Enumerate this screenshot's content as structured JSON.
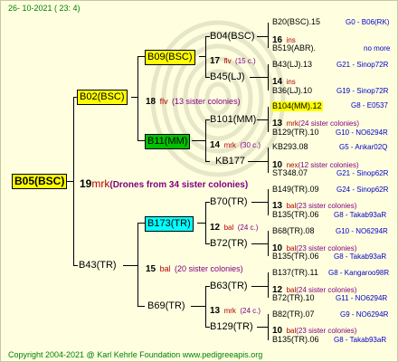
{
  "date": "26- 10-2021 (  23:  4)",
  "footer": "Copyright 2004-2021 @ Karl Kehrle Foundation    www.pedigreeapis.org",
  "root": {
    "name": "B05(BSC)",
    "num": "19",
    "race": "mrk",
    "colonies": "(Drones from 34 sister colonies)",
    "color": "#ffff00"
  },
  "gen1": [
    {
      "name": "B02(BSC)",
      "num": "18",
      "race": "flv",
      "colonies": "(13 sister colonies)",
      "color": "#ffff00"
    },
    {
      "name": "B43(TR)",
      "num": "15",
      "race": "bal",
      "colonies": "(20 sister colonies)"
    }
  ],
  "gen2": [
    {
      "name": "B09(BSC)",
      "num": "17",
      "race": "flv",
      "colonies": "(15 c.)",
      "color": "#ffff00"
    },
    {
      "name": "B11(MM)",
      "num": "14",
      "race": "mrk",
      "colonies": "(30 c.)",
      "color": "#00c000"
    },
    {
      "name": "B173(TR)",
      "num": "12",
      "race": "bal",
      "colonies": "(24 c.)",
      "color": "#00ffff"
    },
    {
      "name": "B69(TR)",
      "num": "13",
      "race": "mrk",
      "colonies": "(24 c.)"
    }
  ],
  "gen3": [
    {
      "name": "B04(BSC)",
      "num": "16",
      "race": "ins",
      "colonies": ""
    },
    {
      "name": "B45(LJ)",
      "num": "14",
      "race": "ins",
      "colonies": ""
    },
    {
      "name": "B101(MM)",
      "num": "13",
      "race": "mrk",
      "colonies": "(24 sister colonies)"
    },
    {
      "name": "KB177",
      "num": "10",
      "race": "nex",
      "colonies": "(12 sister colonies)"
    },
    {
      "name": "B70(TR)",
      "num": "13",
      "race": "bal",
      "colonies": "(23 sister colonies)"
    },
    {
      "name": "B72(TR)",
      "num": "10",
      "race": "bal",
      "colonies": "(23 sister colonies)"
    },
    {
      "name": "B63(TR)",
      "num": "12",
      "race": "bal",
      "colonies": "(24 sister colonies)"
    },
    {
      "name": "B129(TR)",
      "num": "10",
      "race": "bal",
      "colonies": "(23 sister colonies)"
    }
  ],
  "gen4": [
    {
      "name": "B20(BSC).15",
      "code": "G0 - B06(RK)"
    },
    {
      "name": "B519(ABR).",
      "code": "no more"
    },
    {
      "name": "B43(LJ).13",
      "code": "G21 - Sinop72R"
    },
    {
      "name": "B36(LJ).10",
      "code": "G19 - Sinop72R"
    },
    {
      "name": "B104(MM).12",
      "code": "G8 - E0537",
      "highlight": "#ffff00"
    },
    {
      "name": "B129(TR).10",
      "code": "G10 - NO6294R"
    },
    {
      "name": "KB293.08",
      "code": "G5 - Ankar02Q"
    },
    {
      "name": "ST348.07",
      "code": "G21 - Sinop62R"
    },
    {
      "name": "B149(TR).09",
      "code": "G24 - Sinop62R"
    },
    {
      "name": "B135(TR).06",
      "code": "G8 - Takab93aR"
    },
    {
      "name": "B68(TR).08",
      "code": "G10 - NO6294R"
    },
    {
      "name": "B135(TR).06",
      "code": "G8 - Takab93aR"
    },
    {
      "name": "B137(TR).11",
      "code": "G8 - Kangaroo98R"
    },
    {
      "name": "B72(TR).10",
      "code": "G11 - NO6294R"
    },
    {
      "name": "B82(TR).07",
      "code": "G9 - NO6294R"
    },
    {
      "name": "B135(TR).06",
      "code": "G8 - Takab93aR"
    }
  ]
}
